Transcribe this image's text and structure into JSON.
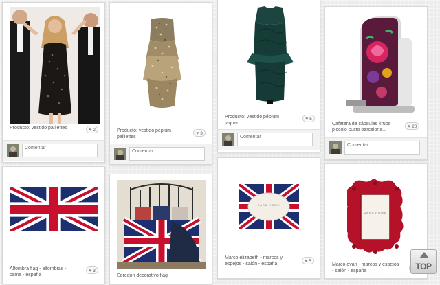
{
  "pins": [
    {
      "description": "Producto: vestido paillettes",
      "likes": "2",
      "comment_placeholder": "Comentar"
    },
    {
      "description": "Producto: vestido péplum paillettes",
      "likes": "3",
      "comment_placeholder": "Comentar"
    },
    {
      "description": "Producto: vestido péplum jaquar",
      "likes": "5",
      "comment_placeholder": "Comentar"
    },
    {
      "description": "Cafetera de cápsulas krups piccolo custo barcelona...",
      "likes": "20",
      "comment_placeholder": "Comentar"
    },
    {
      "description": "Alfombra flag - alfombras - cama - españa",
      "likes": "3"
    },
    {
      "description": "Edredón decorativo flag -"
    },
    {
      "description": "Marco elizabeth - marcos y espejos - salón - españa",
      "likes": "5"
    },
    {
      "description": "Marco evan - marcos y espejos - salón - españa",
      "likes": "5"
    }
  ],
  "frame_brand": "ZARA HOME",
  "top_button": {
    "label": "TOP"
  },
  "colors": {
    "flag_blue": "#1d2f6e",
    "flag_red": "#c8102e",
    "frame_red": "#b5122a"
  }
}
